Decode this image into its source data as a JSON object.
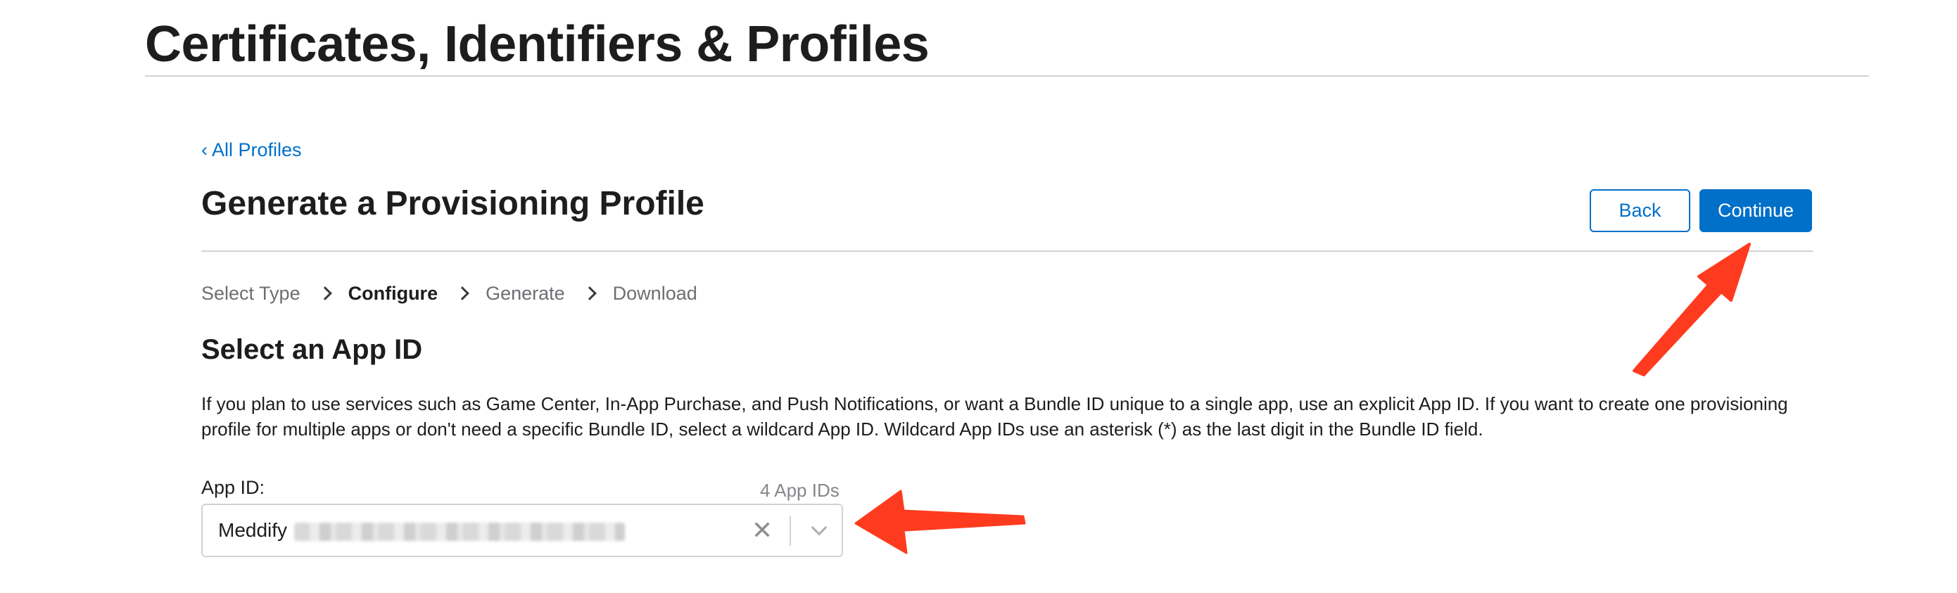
{
  "header": {
    "title": "Certificates, Identifiers & Profiles"
  },
  "nav": {
    "back_link": "All Profiles",
    "back_chevron": "‹"
  },
  "page": {
    "heading": "Generate a Provisioning Profile"
  },
  "actions": {
    "back_label": "Back",
    "continue_label": "Continue"
  },
  "steps": [
    {
      "label": "Select Type",
      "active": false
    },
    {
      "label": "Configure",
      "active": true
    },
    {
      "label": "Generate",
      "active": false
    },
    {
      "label": "Download",
      "active": false
    }
  ],
  "section": {
    "heading": "Select an App ID",
    "description": "If you plan to use services such as Game Center, In-App Purchase, and Push Notifications, or want a Bundle ID unique to a single app, use an explicit App ID. If you want to create one provisioning profile for multiple apps or don't need a specific Bundle ID, select a wildcard App ID. Wildcard App IDs use an asterisk (*) as the last digit in the Bundle ID field."
  },
  "app_id_field": {
    "label": "App ID:",
    "count": "4 App IDs",
    "selected_value": "Meddify",
    "clear_glyph": "✕"
  },
  "colors": {
    "accent": "#0070c9",
    "annotation_arrow": "#ff3b1f"
  },
  "icons": [
    "chevron-left-icon",
    "chevron-right-icon",
    "clear-icon",
    "chevron-down-icon",
    "annotation-arrow"
  ]
}
